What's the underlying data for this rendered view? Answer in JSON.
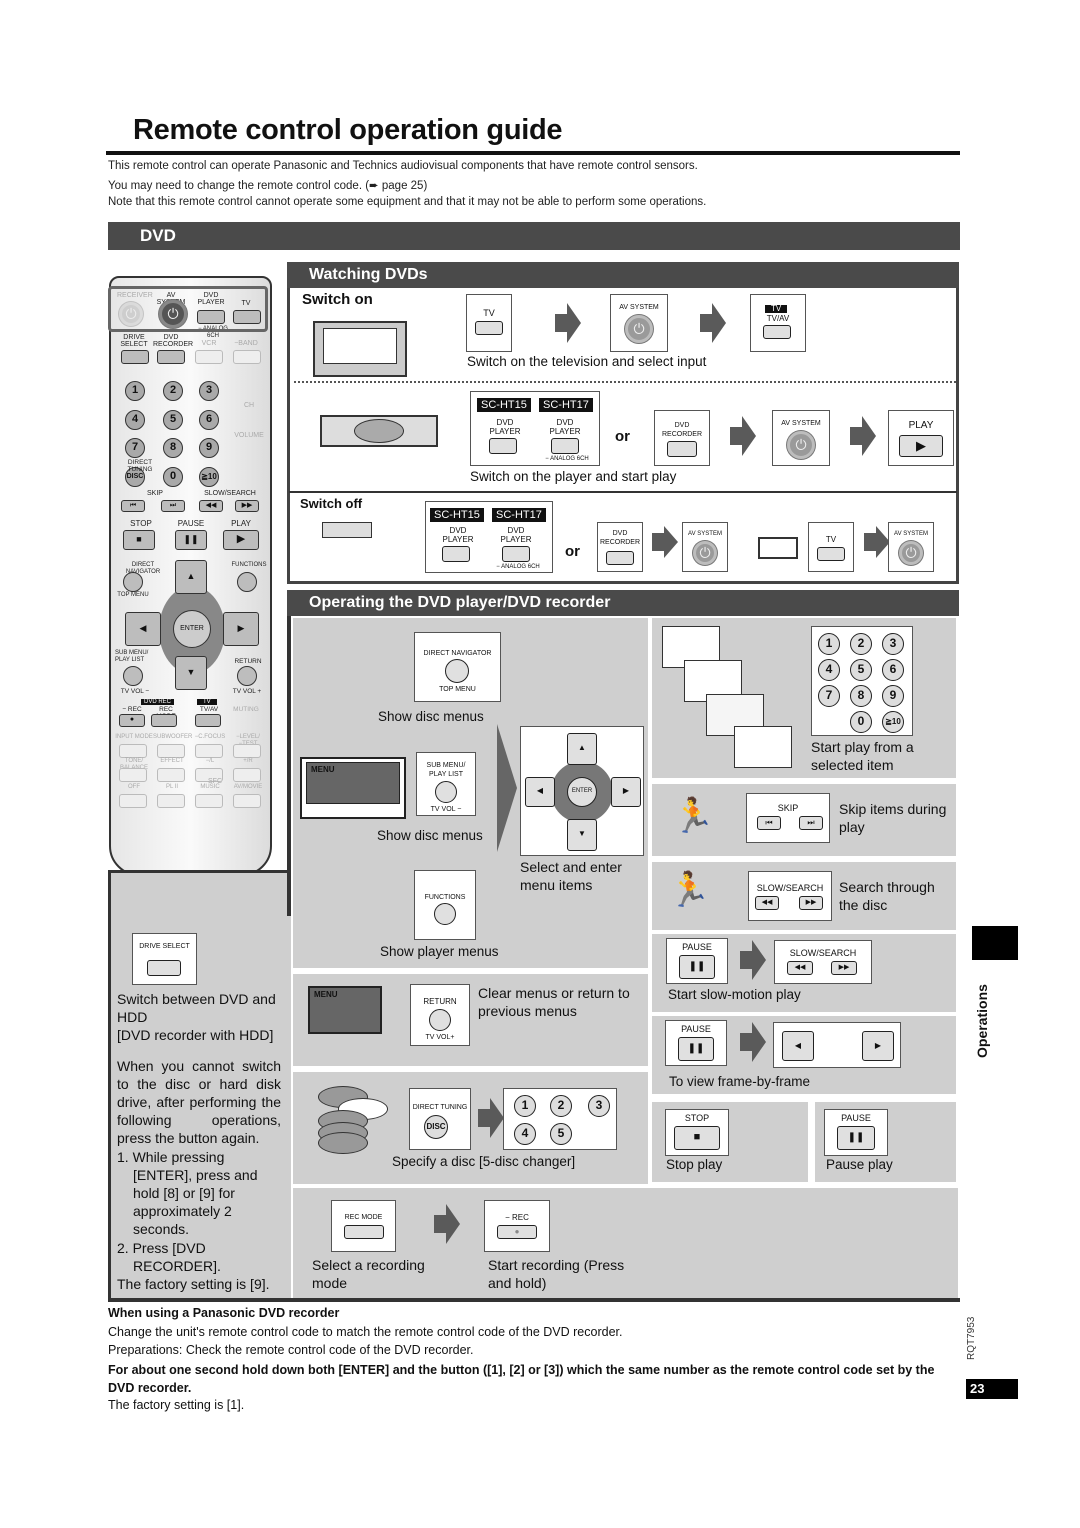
{
  "title": "Remote control operation guide",
  "intro": [
    "This remote control can operate Panasonic and Technics audiovisual components that have remote control sensors.",
    "You may need to change the remote control code. (➨ page 25)",
    "Note that this remote control cannot operate some equipment and that it may not be able to perform some operations."
  ],
  "section_bar": "DVD",
  "remote": {
    "top_row": [
      "RECEIVER",
      "AV SYSTEM",
      "DVD PLAYER",
      "TV"
    ],
    "analog": "− ANALOG 6CH",
    "row2": [
      "DRIVE SELECT",
      "DVD RECORDER",
      "VCR",
      "−BAND"
    ],
    "numbers": [
      "1",
      "2",
      "3",
      "4",
      "5",
      "6",
      "7",
      "8",
      "9",
      "0",
      "≧10"
    ],
    "disc": "DISC",
    "direct_tuning": "DIRECT TUNING",
    "ch": "CH",
    "volume": "VOLUME",
    "skip": "SKIP",
    "slow_search": "SLOW/SEARCH",
    "stop": "STOP",
    "pause": "PAUSE",
    "play": "PLAY",
    "direct_navigator": "DIRECT NAVIGATOR",
    "top_menu": "TOP MENU",
    "functions": "FUNCTIONS",
    "enter": "ENTER",
    "sub_menu": "SUB MENU/ PLAY LIST",
    "return": "RETURN",
    "tv_vol_minus": "TV VOL −",
    "tv_vol_plus": "TV VOL +",
    "dvd_rec": "DVD REC",
    "rec": "− REC",
    "rec_mode": "REC MODE",
    "tv_tag": "TV",
    "tv_av": "TV/AV",
    "muting": "MUTING",
    "row_a": [
      "INPUT MODE",
      "SUBWOOFER",
      "−C.FOCUS",
      "−LEVEL/ −TEST"
    ],
    "row_b": [
      "TONE/ BALANCE",
      "EFFECT",
      "−/L",
      "+/R"
    ],
    "sfc": "SFC",
    "row_c": [
      "OFF",
      "PL II",
      "MUSIC",
      "AV/MOVIE"
    ]
  },
  "watching": {
    "header": "Watching DVDs",
    "switch_on": "Switch on",
    "tv_label": "TV",
    "av_system": "AV SYSTEM",
    "tv_tag": "TV",
    "tv_av": "TV/AV",
    "caption_tv": "Switch on the television and select input",
    "sc_ht15": "SC-HT15",
    "sc_ht17": "SC-HT17",
    "dvd_player": "DVD PLAYER",
    "analog": "− ANALOG 6CH",
    "or": "or",
    "dvd_recorder": "DVD RECORDER",
    "play": "PLAY",
    "caption_player": "Switch on the player and start play",
    "switch_off": "Switch off"
  },
  "operating": {
    "header": "Operating the DVD player/DVD recorder",
    "direct_navigator": "DIRECT NAVIGATOR",
    "top_menu": "TOP MENU",
    "show_disc_menus": "Show disc menus",
    "menu": "MENU",
    "sub_menu": "SUB MENU/ PLAY LIST",
    "tv_vol_minus": "TV VOL −",
    "show_disc_menus_2": "Show disc menus",
    "enter": "ENTER",
    "select_enter": "Select and enter menu items",
    "functions": "FUNCTIONS",
    "show_player_menus": "Show player menus",
    "return": "RETURN",
    "tv_vol_plus": "TV VOL+",
    "clear_menus": "Clear menus or return to previous menus",
    "direct_tuning": "DIRECT TUNING",
    "disc": "DISC",
    "disc_numbers": [
      "1",
      "2",
      "3",
      "4",
      "5"
    ],
    "specify_disc": "Specify a disc [5-disc changer]",
    "rec_mode": "REC MODE",
    "rec": "− REC",
    "select_mode": "Select a recording mode",
    "start_recording": "Start recording (Press and hold)",
    "numpad": [
      "1",
      "2",
      "3",
      "4",
      "5",
      "6",
      "7",
      "8",
      "9",
      "0",
      "≧10"
    ],
    "start_from_item": "Start play from a selected item",
    "skip": "SKIP",
    "skip_caption": "Skip items during play",
    "slow_search": "SLOW/SEARCH",
    "search_caption": "Search through the disc",
    "pause": "PAUSE",
    "slow_caption": "Start slow-motion play",
    "frame_caption": "To view frame-by-frame",
    "stop": "STOP",
    "stop_caption": "Stop play",
    "pause_caption": "Pause play"
  },
  "drive": {
    "button": "DRIVE SELECT",
    "caption": "Switch between DVD and HDD",
    "note": "[DVD recorder with HDD]",
    "para": "When you cannot switch to the disc or hard disk drive, after performing the following operations, press the button again.",
    "step1": "1. While pressing [ENTER], press and hold [8] or [9] for approximately 2 seconds.",
    "step2": "2. Press [DVD RECORDER].",
    "factory": "The factory setting is [9]."
  },
  "footer": {
    "heading": "When using a Panasonic DVD recorder",
    "line1": "Change the unit's remote control code to match the remote control code of the DVD recorder.",
    "line2": "Preparations: Check the remote control code of the DVD recorder.",
    "bold": "For about one second hold down both [ENTER] and the button ([1], [2] or [3]) which the same number as the remote control code set by the DVD recorder.",
    "factory": "The factory setting is [1]."
  },
  "side": {
    "tab": "Operations",
    "doc_code": "RQT7953",
    "page": "23"
  }
}
